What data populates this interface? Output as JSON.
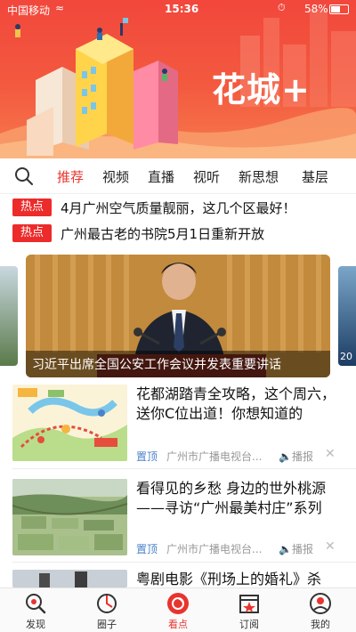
{
  "status_bar": {
    "carrier": "中国移动",
    "time": "15:36",
    "battery": "58%"
  },
  "banner": {
    "brand": "花城+"
  },
  "nav": {
    "tabs": [
      {
        "label": "推荐",
        "active": true
      },
      {
        "label": "视频",
        "active": false
      },
      {
        "label": "直播",
        "active": false
      },
      {
        "label": "视听",
        "active": false
      },
      {
        "label": "新思想",
        "active": false
      },
      {
        "label": "基层",
        "active": false
      }
    ]
  },
  "hot": {
    "badge": "热点",
    "items": [
      "4月广州空气质量靓丽，这几个区最好！",
      "广州最古老的书院5月1日重新开放"
    ]
  },
  "carousel": {
    "caption": "习近平出席全国公安工作会议并发表重要讲话",
    "right_peek_text": "20"
  },
  "news": [
    {
      "title": "花都湖踏青全攻略，这个周六，送你C位出道！你想知道的",
      "pin": "置顶",
      "source": "广州市广播电视台...",
      "play": "播报",
      "close": "✕"
    },
    {
      "title": "看得见的乡愁 身边的世外桃源——寻访“广州最美村庄”系列",
      "pin": "置顶",
      "source": "广州市广播电视台...",
      "play": "播报",
      "close": "✕"
    },
    {
      "title": "粤剧电影《刑场上的婚礼》杀"
    }
  ],
  "tabbar": {
    "tabs": [
      {
        "label": "发现",
        "icon": "discover-icon"
      },
      {
        "label": "圈子",
        "icon": "circle-icon"
      },
      {
        "label": "看点",
        "icon": "highlights-icon",
        "active": true
      },
      {
        "label": "订阅",
        "icon": "subscribe-icon"
      },
      {
        "label": "我的",
        "icon": "profile-icon"
      }
    ]
  },
  "colors": {
    "accent": "#e8342e",
    "hot_badge": "#ec2b2b",
    "pin": "#4a82c8"
  }
}
